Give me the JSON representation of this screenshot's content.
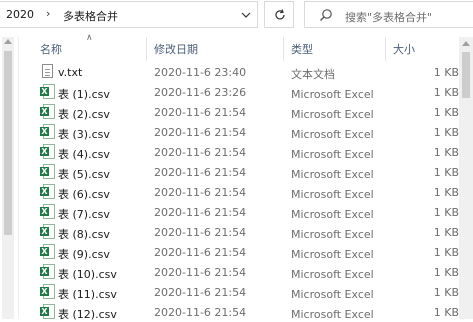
{
  "address_bar": {
    "breadcrumbs": [
      "2020",
      "多表格合并"
    ]
  },
  "search": {
    "placeholder": "搜索\"多表格合并\""
  },
  "columns": {
    "name": "名称",
    "modified": "修改日期",
    "type": "类型",
    "size": "大小"
  },
  "files": [
    {
      "name": "v.txt",
      "modified": "2020-11-6 23:40",
      "type": "文本文档",
      "size": "1 KB",
      "icon": "text-file-icon"
    },
    {
      "name": "表 (1).csv",
      "modified": "2020-11-6 23:26",
      "type": "Microsoft Excel 逗号分隔值文件",
      "size": "1 KB",
      "icon": "excel-csv-icon"
    },
    {
      "name": "表 (2).csv",
      "modified": "2020-11-6 21:54",
      "type": "Microsoft Excel 逗号分隔值文件",
      "size": "1 KB",
      "icon": "excel-csv-icon"
    },
    {
      "name": "表 (3).csv",
      "modified": "2020-11-6 21:54",
      "type": "Microsoft Excel 逗号分隔值文件",
      "size": "1 KB",
      "icon": "excel-csv-icon"
    },
    {
      "name": "表 (4).csv",
      "modified": "2020-11-6 21:54",
      "type": "Microsoft Excel 逗号分隔值文件",
      "size": "1 KB",
      "icon": "excel-csv-icon"
    },
    {
      "name": "表 (5).csv",
      "modified": "2020-11-6 21:54",
      "type": "Microsoft Excel 逗号分隔值文件",
      "size": "1 KB",
      "icon": "excel-csv-icon"
    },
    {
      "name": "表 (6).csv",
      "modified": "2020-11-6 21:54",
      "type": "Microsoft Excel 逗号分隔值文件",
      "size": "1 KB",
      "icon": "excel-csv-icon"
    },
    {
      "name": "表 (7).csv",
      "modified": "2020-11-6 21:54",
      "type": "Microsoft Excel 逗号分隔值文件",
      "size": "1 KB",
      "icon": "excel-csv-icon"
    },
    {
      "name": "表 (8).csv",
      "modified": "2020-11-6 21:54",
      "type": "Microsoft Excel 逗号分隔值文件",
      "size": "1 KB",
      "icon": "excel-csv-icon"
    },
    {
      "name": "表 (9).csv",
      "modified": "2020-11-6 21:54",
      "type": "Microsoft Excel 逗号分隔值文件",
      "size": "1 KB",
      "icon": "excel-csv-icon"
    },
    {
      "name": "表 (10).csv",
      "modified": "2020-11-6 21:54",
      "type": "Microsoft Excel 逗号分隔值文件",
      "size": "1 KB",
      "icon": "excel-csv-icon"
    },
    {
      "name": "表 (11).csv",
      "modified": "2020-11-6 21:54",
      "type": "Microsoft Excel 逗号分隔值文件",
      "size": "1 KB",
      "icon": "excel-csv-icon"
    },
    {
      "name": "表 (12).csv",
      "modified": "2020-11-6 21:54",
      "type": "Microsoft Excel 逗号分隔值文件",
      "size": "1 KB",
      "icon": "excel-csv-icon"
    }
  ],
  "colors": {
    "header_text": "#4c607a",
    "excel_green": "#1f7a44"
  }
}
